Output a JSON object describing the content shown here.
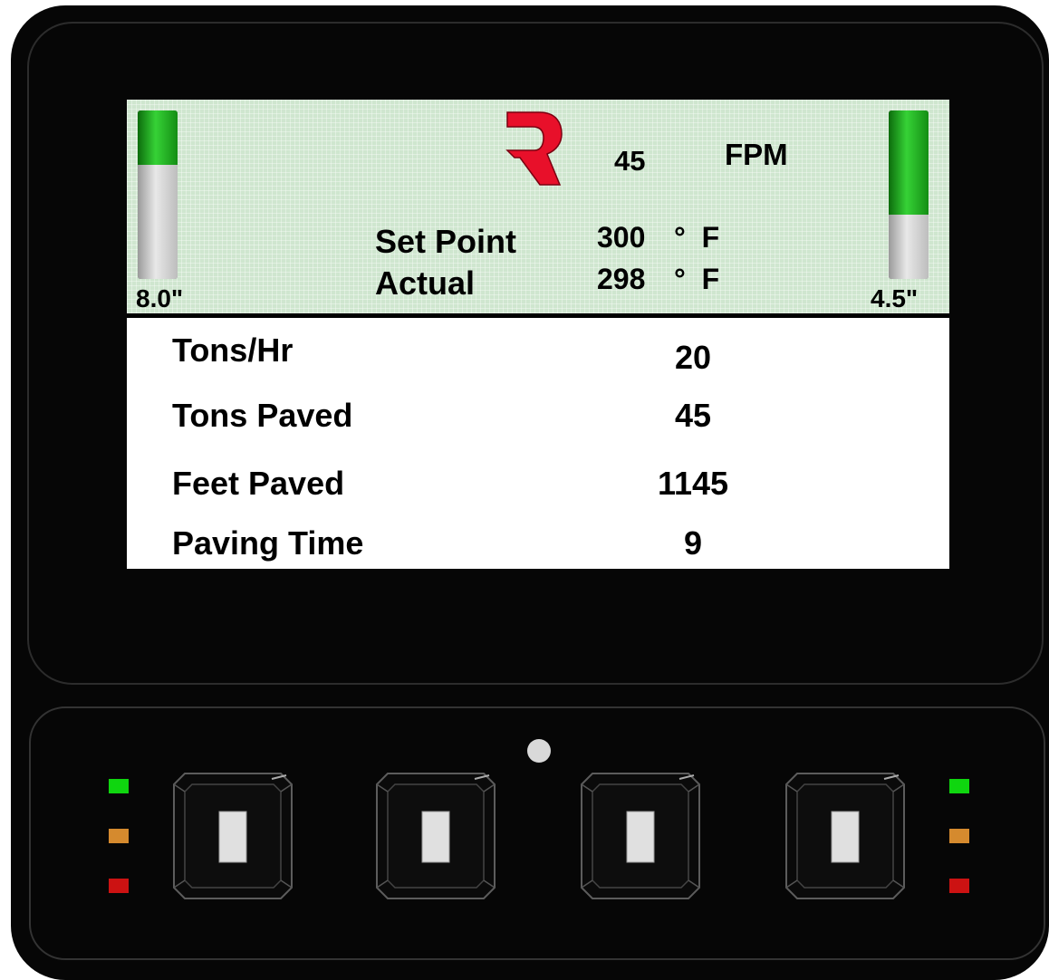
{
  "display": {
    "left_gauge": {
      "label": "8.0\"",
      "level_fraction": 0.32
    },
    "right_gauge": {
      "label": "4.5\"",
      "level_fraction": 0.62
    },
    "speed": {
      "value": "45",
      "unit": "FPM"
    },
    "temperature": {
      "set_point_label": "Set Point",
      "set_point_value": "300",
      "actual_label": "Actual",
      "actual_value": "298",
      "unit": "°  F"
    },
    "stats": [
      {
        "label": "Tons/Hr",
        "value": "20"
      },
      {
        "label": "Tons Paved",
        "value": "45"
      },
      {
        "label": "Feet Paved",
        "value": "1145"
      },
      {
        "label": "Paving Time",
        "value": "9"
      }
    ],
    "logo_icon": "roadtec-r-logo-icon",
    "colors": {
      "gauge_fill": "#22c422",
      "logo_red": "#e8102a",
      "screen_bg": "#cfe6cf"
    }
  },
  "keypad": {
    "left_leds": [
      "green",
      "orange",
      "red"
    ],
    "right_leds": [
      "green",
      "orange",
      "red"
    ],
    "led_colors": {
      "green": "#0fd60f",
      "orange": "#d58a2e",
      "red": "#cc1212"
    },
    "buttons": [
      "soft-key-1",
      "soft-key-2",
      "soft-key-3",
      "soft-key-4"
    ]
  }
}
